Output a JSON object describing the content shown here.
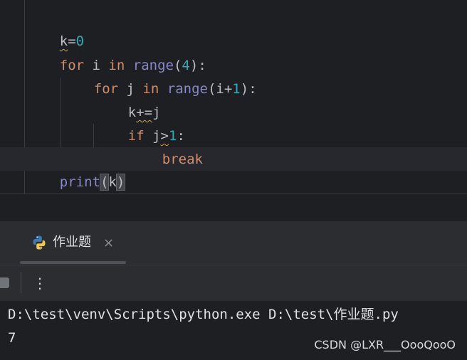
{
  "editor": {
    "lines": [
      {
        "k": "k",
        "eq": "=",
        "zero": "0"
      },
      {
        "for_kw": "for",
        "var": " i ",
        "in_kw": "in",
        "range_fn": "range",
        "open": "(",
        "num": "4",
        "close": "):"
      },
      {
        "for_kw": "for",
        "var": " j ",
        "in_kw": "in",
        "range_fn": "range",
        "open": "(i+",
        "num": "1",
        "close": "):"
      },
      {
        "k": "k",
        "op": "+=",
        "rest": "j"
      },
      {
        "if_kw": "if",
        "var": " j",
        "gt": ">",
        "num": "1",
        "colon": ":"
      },
      {
        "break_kw": "break"
      },
      {
        "print_fn": "print",
        "open": "(",
        "arg": "k",
        "close": ")"
      }
    ]
  },
  "run_panel": {
    "tab_label": "作业题",
    "tab_close": "×",
    "more_label": "⋮"
  },
  "console": {
    "command": "D:\\test\\venv\\Scripts\\python.exe D:\\test\\作业题.py",
    "output": "7"
  },
  "watermark": "CSDN @LXR___OooQooO",
  "icons": {
    "file_icon": "python-icon",
    "stop": "stop-icon",
    "more": "more-vertical-icon",
    "close": "close-icon"
  },
  "colors": {
    "background": "#1e1f22",
    "panel": "#2b2d30",
    "keyword": "#cf8e6d",
    "builtin": "#8888c6",
    "number": "#2aacb8",
    "text": "#bcbec4"
  }
}
